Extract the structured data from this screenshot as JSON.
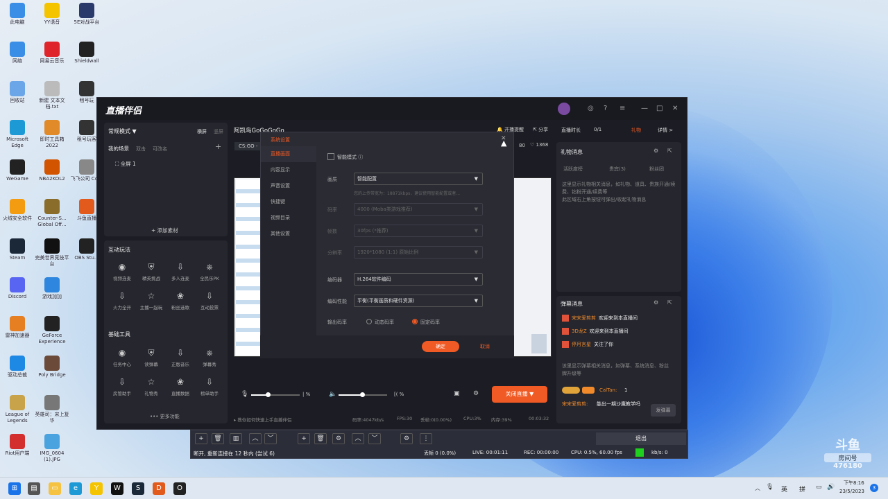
{
  "desktop": {
    "icons": [
      {
        "label": "此电脑",
        "icon": "computer-icon",
        "color": "#3a8ee6"
      },
      {
        "label": "YY语音",
        "icon": "yy-icon",
        "color": "#f5c400"
      },
      {
        "label": "5E对战平台",
        "icon": "5e-icon",
        "color": "#2a3a6a"
      },
      {
        "label": "网络",
        "icon": "network-icon",
        "color": "#3a8ee6"
      },
      {
        "label": "网易云音乐",
        "icon": "netease-music-icon",
        "color": "#e0242b"
      },
      {
        "label": "Shieldwall",
        "icon": "shieldwall-icon",
        "color": "#222"
      },
      {
        "label": "回收站",
        "icon": "recycle-bin-icon",
        "color": "#6aa6e8"
      },
      {
        "label": "新建 文本文档.txt",
        "icon": "text-file-icon",
        "color": "#bbb"
      },
      {
        "label": "租号玩",
        "icon": "zuhao-icon",
        "color": "#333"
      },
      {
        "label": "Microsoft Edge",
        "icon": "edge-icon",
        "color": "#1d9ad6"
      },
      {
        "label": "即时工具箱 2022",
        "icon": "toolbox-icon",
        "color": "#e08a2a"
      },
      {
        "label": "租号玩客",
        "icon": "zuhao-client-icon",
        "color": "#333"
      },
      {
        "label": "WeGame",
        "icon": "wegame-icon",
        "color": "#222"
      },
      {
        "label": "NBA2KOL2",
        "icon": "nba-icon",
        "color": "#d35400"
      },
      {
        "label": "飞飞公司 Corp",
        "icon": "corp-icon",
        "color": "#888"
      },
      {
        "label": "火绒安全软件",
        "icon": "huorong-icon",
        "color": "#f39c12"
      },
      {
        "label": "Counter-S... Global Off...",
        "icon": "csgo-icon",
        "color": "#8a6d2a"
      },
      {
        "label": "斗鱼直播",
        "icon": "douyu-icon",
        "color": "#e25a1c"
      },
      {
        "label": "Steam",
        "icon": "steam-icon",
        "color": "#1b2838"
      },
      {
        "label": "完美世界竞技平台",
        "icon": "perfect-world-icon",
        "color": "#111"
      },
      {
        "label": "OBS Stu...",
        "icon": "obs-icon",
        "color": "#222"
      },
      {
        "label": "Discord",
        "icon": "discord-icon",
        "color": "#5865f2"
      },
      {
        "label": "游戏加加",
        "icon": "game-plus-icon",
        "color": "#2e86de"
      },
      {
        "label": "雷神加速器",
        "icon": "leishen-icon",
        "color": "#e67e22"
      },
      {
        "label": "GeForce Experience",
        "icon": "geforce-icon",
        "color": "#222"
      },
      {
        "label": "驱动总裁",
        "icon": "driver-icon",
        "color": "#1e88e5"
      },
      {
        "label": "Poly Bridge",
        "icon": "poly-bridge-icon",
        "color": "#6b4a3a"
      },
      {
        "label": "League of Legends",
        "icon": "lol-icon",
        "color": "#c9a34a"
      },
      {
        "label": "英雄司：宋上复华",
        "icon": "hero-icon",
        "color": "#777"
      },
      {
        "label": "Riot用户端",
        "icon": "riot-icon",
        "color": "#d32f2f"
      },
      {
        "label": "IMG_0604 (1).JPG",
        "icon": "image-file-icon",
        "color": "#4aa3df"
      }
    ]
  },
  "app": {
    "brand": "直播伴侣",
    "left": {
      "mode": "常规模式 ▼",
      "mode_btn1": "横屏",
      "mode_btn2": "竖屏",
      "scenes_title": "我的场景",
      "scenes_a": "双击",
      "scenes_b": "可改名",
      "scene1": "全屏 1",
      "add_material": "+ 添加素材",
      "interact_title": "互动玩法",
      "interact": [
        "视频连麦",
        "精英挑战",
        "多人连麦",
        "全民乐PK",
        "火力全开",
        "主播一起玩",
        "粉丝选歌",
        "互动投票"
      ],
      "basic_title": "基础工具",
      "basic": [
        "任务中心",
        "读弹幕",
        "正版音乐",
        "弹幕秀",
        "房管助手",
        "礼物秀",
        "直播数据",
        "榜单助手"
      ],
      "more": "••• 更多功能"
    },
    "center": {
      "room": "阿凯鸟GoGoGoGo",
      "open_notice": "开播提醒",
      "share": "分享",
      "tab": "CS:GO -",
      "viewers": "80",
      "likes": "1368",
      "mic": "| %",
      "speaker": "[( %",
      "close_live": "关闭直播 ▼",
      "hint": "教你如何快速上手直播伴侣",
      "bitrate": "码率:4047kb/s",
      "fps": "FPS:30",
      "drop": "丢帧:0(0.00%)",
      "cpu": "CPU:3%",
      "mem": "内存:39%",
      "time": "00:03:32"
    },
    "right": {
      "live_time_label": "直播时长",
      "live_time": "0/1",
      "gift": "礼物",
      "detail": "详情 >",
      "gift_msg_title": "礼物消息",
      "gift_tabs": [
        "活跃度榜",
        "贵宾(3)",
        "粉丝团"
      ],
      "gift_info": "这里显示礼物相关消息，如礼物、道具、贵族开通/续费、钻粉开通/续费等\n此区域右上角按钮可弹出/收起礼物消息",
      "danmu_title": "弹幕消息",
      "danmu": [
        {
          "user": "宋宋爱剪剪",
          "text": "欢迎来到本直播间"
        },
        {
          "user": "3D龙Z",
          "text": "欢迎来到本直播间"
        },
        {
          "user": "停月言星",
          "text": "关注了你"
        }
      ],
      "danmu_info": "该里显示弹幕相关消息，如弹幕、系统消息、粉丝牌升级等",
      "calltan": "CalTan:",
      "calltan_n": "1",
      "last_user": "宋宋爱剪剪:",
      "last_text": "能出一期沙鹰教学吗",
      "send": "发弹幕"
    }
  },
  "dialog": {
    "title": "系统设置",
    "nav": [
      "直播画面",
      "内容显示",
      "声音设置",
      "快捷键",
      "视频目录",
      "其他设置"
    ],
    "smart_mode": "智能模式 ⓘ",
    "quality_label": "画质",
    "quality": "智能配置",
    "quality_hint": "您的上传带宽为：18871kbps，建议使用智能配置或者...",
    "bitrate_label": "码率",
    "bitrate": "4000 (Moba类游戏推荐)",
    "fps_label": "帧数",
    "fps": "30fps (*推荐)",
    "res_label": "分辨率",
    "res": "1920*1080 (1:1) 原始比例",
    "encoder_label": "编码器",
    "encoder": "H.264软件编码",
    "perf_label": "编码性能",
    "perf": "平衡(平衡画质和硬件资源)",
    "rate_label": "输出码率",
    "dynamic": "动态码率",
    "fixed": "固定码率",
    "ok": "确定",
    "cancel": "取消"
  },
  "obs": {
    "exit": "退出",
    "status": "断开, 重新连接在 12 秒内 (尝试 6)",
    "drop": "丢帧 0 (0.0%)",
    "live": "LIVE: 00:01:11",
    "rec": "REC: 00:00:00",
    "cpu": "CPU: 0.5%, 60.00 fps",
    "kbs": "kb/s: 0"
  },
  "watermark": {
    "brand": "斗鱼",
    "sub": "房间号",
    "num": "476180"
  },
  "taskbar": {
    "lang": "英",
    "ime": "拼",
    "time": "下午8:16",
    "date": "23/5/2023",
    "notif": "3"
  }
}
